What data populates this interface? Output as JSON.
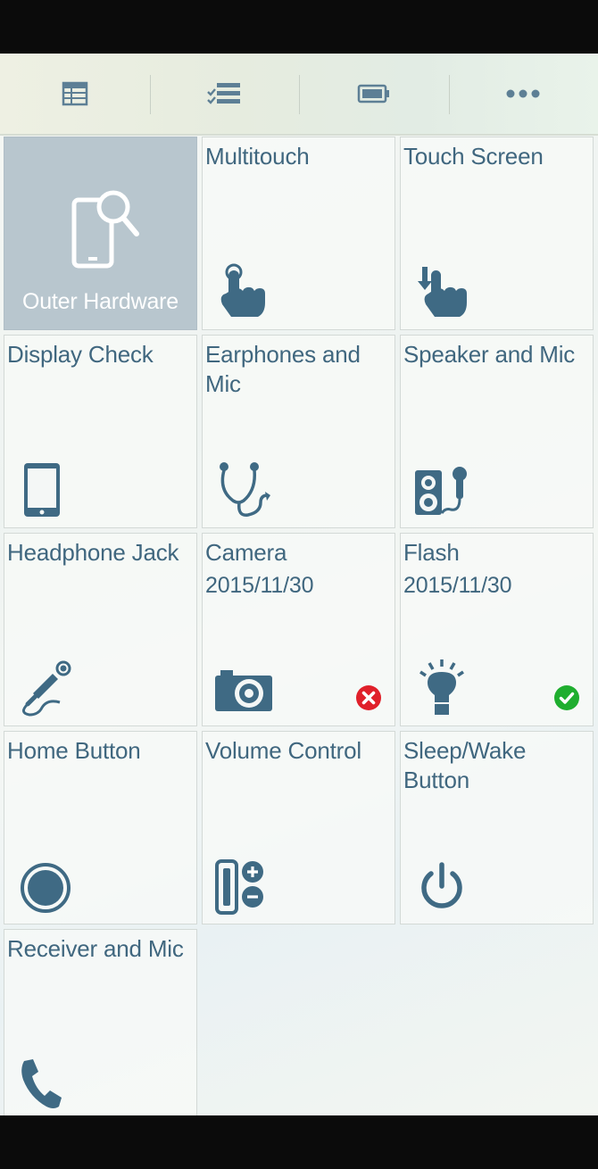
{
  "toolbar": {
    "tabs": [
      {
        "icon": "table-icon"
      },
      {
        "icon": "checklist-icon"
      },
      {
        "icon": "battery-icon"
      },
      {
        "icon": "more-icon"
      }
    ]
  },
  "tiles": [
    {
      "label": "Outer Hardware",
      "icon": "phone-search-icon",
      "selected": true
    },
    {
      "label": "Multitouch",
      "icon": "multitouch-icon"
    },
    {
      "label": "Touch Screen",
      "icon": "touch-screen-icon"
    },
    {
      "label": "Display Check",
      "icon": "display-icon"
    },
    {
      "label": "Earphones and Mic",
      "icon": "earphones-icon"
    },
    {
      "label": "Speaker and Mic",
      "icon": "speaker-mic-icon"
    },
    {
      "label": "Headphone Jack",
      "icon": "headphone-jack-icon"
    },
    {
      "label": "Camera",
      "date": "2015/11/30",
      "icon": "camera-icon",
      "status": "fail"
    },
    {
      "label": "Flash",
      "date": "2015/11/30",
      "icon": "flash-icon",
      "status": "pass"
    },
    {
      "label": "Home Button",
      "icon": "home-button-icon"
    },
    {
      "label": "Volume Control",
      "icon": "volume-control-icon"
    },
    {
      "label": "Sleep/Wake Button",
      "icon": "power-icon"
    },
    {
      "label": "Receiver and Mic",
      "icon": "phone-receiver-icon"
    }
  ],
  "colors": {
    "icon": "#3f6a84",
    "label": "#40677f",
    "selected_tile": "#b8c6ce",
    "fail": "#e0202a",
    "pass": "#1fae2f"
  }
}
